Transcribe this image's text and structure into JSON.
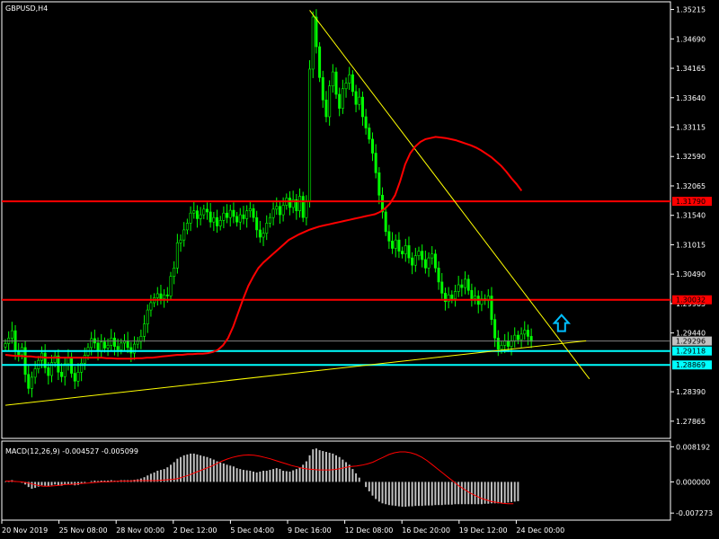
{
  "chart_data": {
    "type": "candlestick",
    "symbol_label": "GBPUSD,H4",
    "colors": {
      "background": "#000000",
      "frame": "#ffffff",
      "bull": "#00ff00",
      "bear": "#00ff00",
      "ma": "#ff0000",
      "resistance": "#ff0000",
      "support": "#00ffff",
      "trendline": "#ffff00",
      "histogram": "#c0c0c0",
      "signal": "#ff0000",
      "arrow": "#00bfff"
    },
    "y_axis": {
      "min": 1.2759,
      "max": 1.3532,
      "ticks": [
        "1.35215",
        "1.34690",
        "1.34165",
        "1.33640",
        "1.33115",
        "1.32590",
        "1.32065",
        "1.31540",
        "1.31015",
        "1.30490",
        "1.29965",
        "1.29440",
        "1.28390",
        "1.27865"
      ]
    },
    "x_axis": {
      "labels": [
        "20 Nov 2019",
        "25 Nov 08:00",
        "28 Nov 00:00",
        "2 Dec 12:00",
        "5 Dec 04:00",
        "9 Dec 16:00",
        "12 Dec 08:00",
        "16 Dec 20:00",
        "19 Dec 12:00",
        "24 Dec 00:00"
      ]
    },
    "closes": [
      1.2925,
      1.2935,
      1.2948,
      1.2912,
      1.2905,
      1.2918,
      1.287,
      1.2845,
      1.2865,
      1.288,
      1.2895,
      1.2908,
      1.2882,
      1.2868,
      1.2891,
      1.2903,
      1.2874,
      1.2866,
      1.2889,
      1.2901,
      1.2872,
      1.2858,
      1.2874,
      1.289,
      1.2904,
      1.2918,
      1.2934,
      1.2926,
      1.2911,
      1.2928,
      1.2917,
      1.2922,
      1.2935,
      1.292,
      1.2914,
      1.2926,
      1.293,
      1.2918,
      1.2908,
      1.2924,
      1.2929,
      1.2938,
      1.296,
      1.2985,
      1.2998,
      1.3007,
      1.3014,
      1.3005,
      1.3012,
      1.301,
      1.3045,
      1.306,
      1.3105,
      1.311,
      1.3128,
      1.314,
      1.3158,
      1.3162,
      1.3148,
      1.3155,
      1.3165,
      1.316,
      1.3142,
      1.315,
      1.3135,
      1.3145,
      1.3158,
      1.315,
      1.3163,
      1.3152,
      1.3142,
      1.3155,
      1.3148,
      1.3162,
      1.3166,
      1.315,
      1.3128,
      1.3115,
      1.3122,
      1.314,
      1.315,
      1.3165,
      1.317,
      1.3155,
      1.3172,
      1.3185,
      1.3168,
      1.3182,
      1.3162,
      1.3188,
      1.315,
      1.3178,
      1.3415,
      1.3508,
      1.3455,
      1.34,
      1.336,
      1.333,
      1.3385,
      1.341,
      1.337,
      1.3345,
      1.338,
      1.339,
      1.3405,
      1.3375,
      1.3352,
      1.3365,
      1.333,
      1.331,
      1.329,
      1.3265,
      1.323,
      1.319,
      1.316,
      1.3125,
      1.3108,
      1.3095,
      1.311,
      1.309,
      1.3085,
      1.31,
      1.3078,
      1.3065,
      1.3082,
      1.309,
      1.3075,
      1.306,
      1.3078,
      1.3085,
      1.306,
      1.3035,
      1.3015,
      1.3,
      1.3012,
      1.3005,
      1.3018,
      1.303,
      1.3025,
      1.304,
      1.302,
      1.3005,
      1.301,
      1.2995,
      1.3005,
      1.3002,
      1.301,
      1.2968,
      1.2935,
      1.2915,
      1.2922,
      1.293,
      1.292,
      1.293,
      1.294,
      1.2932,
      1.2942,
      1.2949,
      1.2938,
      1.2929
    ],
    "ma": [
      1.2905,
      1.2904,
      1.2903,
      1.2903,
      1.2902,
      1.2902,
      1.2901,
      1.2901,
      1.29,
      1.29,
      1.29,
      1.29,
      1.29,
      1.29,
      1.29,
      1.29,
      1.29,
      1.29,
      1.29,
      1.29,
      1.2899,
      1.2899,
      1.2898,
      1.2898,
      1.2898,
      1.2898,
      1.2899,
      1.2899,
      1.29,
      1.29,
      1.2901,
      1.2902,
      1.2903,
      1.2904,
      1.2905,
      1.2905,
      1.2906,
      1.2906,
      1.2907,
      1.2907,
      1.2908,
      1.291,
      1.2914,
      1.2922,
      1.2935,
      1.2955,
      1.298,
      1.3005,
      1.3028,
      1.3045,
      1.306,
      1.307,
      1.3078,
      1.3086,
      1.3094,
      1.3102,
      1.311,
      1.3115,
      1.312,
      1.3124,
      1.3128,
      1.3131,
      1.3134,
      1.3136,
      1.3138,
      1.314,
      1.3142,
      1.3144,
      1.3146,
      1.3148,
      1.315,
      1.3152,
      1.3154,
      1.3156,
      1.316,
      1.3166,
      1.3175,
      1.319,
      1.3215,
      1.3245,
      1.3265,
      1.3277,
      1.3285,
      1.329,
      1.3292,
      1.3294,
      1.3293,
      1.3292,
      1.329,
      1.3288,
      1.3285,
      1.3282,
      1.3279,
      1.3275,
      1.327,
      1.3264,
      1.3258,
      1.325,
      1.3242,
      1.3232,
      1.322,
      1.321,
      1.3198
    ],
    "ma_start_index": 0,
    "levels": {
      "resistance": [
        {
          "value": 1.3179,
          "label": "1.31790"
        },
        {
          "value": 1.30032,
          "label": "1.30032"
        }
      ],
      "support": [
        {
          "value": 1.29118,
          "label": "1.29118"
        },
        {
          "value": 1.28869,
          "label": "1.28869"
        }
      ],
      "current": {
        "value": 1.29296,
        "label": "1.29296"
      }
    },
    "trendlines": [
      {
        "from": {
          "index": 0,
          "price": 1.2815
        },
        "to": {
          "index": 162,
          "price": 1.293
        }
      },
      {
        "from": {
          "index": 92,
          "price": 1.352
        },
        "to": {
          "index": 163,
          "price": 1.291
        }
      }
    ],
    "macd": {
      "label": "MACD(12,26,9) -0.004527 -0.005099",
      "y_min": -0.0085,
      "y_max": 0.0091,
      "ticks": [
        "0.008192",
        "0.000000",
        "-0.007273"
      ],
      "histogram": [
        0.0001,
        0.0003,
        0.0004,
        0.0002,
        0.0,
        -0.0002,
        -0.0006,
        -0.0012,
        -0.0016,
        -0.0014,
        -0.0011,
        -0.0008,
        -0.0009,
        -0.001,
        -0.0008,
        -0.0006,
        -0.0008,
        -0.0009,
        -0.0007,
        -0.0005,
        -0.0006,
        -0.0008,
        -0.0007,
        -0.0004,
        -0.0002,
        0.0,
        0.0002,
        0.0003,
        0.0002,
        0.0003,
        0.0003,
        0.0003,
        0.0004,
        0.0003,
        0.0003,
        0.0004,
        0.0004,
        0.0004,
        0.0004,
        0.0005,
        0.0006,
        0.0008,
        0.0011,
        0.0015,
        0.0019,
        0.0022,
        0.0026,
        0.0028,
        0.003,
        0.0034,
        0.004,
        0.0046,
        0.0054,
        0.0058,
        0.0062,
        0.0064,
        0.0066,
        0.0066,
        0.0064,
        0.0062,
        0.006,
        0.0058,
        0.0055,
        0.0052,
        0.0048,
        0.0045,
        0.0043,
        0.004,
        0.0038,
        0.0036,
        0.0032,
        0.003,
        0.0028,
        0.0027,
        0.0026,
        0.0024,
        0.0022,
        0.0024,
        0.0026,
        0.0026,
        0.0028,
        0.003,
        0.0032,
        0.003,
        0.0026,
        0.0025,
        0.0024,
        0.0027,
        0.003,
        0.0034,
        0.004,
        0.0048,
        0.0062,
        0.0076,
        0.0078,
        0.0074,
        0.0072,
        0.007,
        0.0068,
        0.0066,
        0.0062,
        0.0058,
        0.0052,
        0.0046,
        0.004,
        0.003,
        0.002,
        0.001,
        0.0,
        -0.0012,
        -0.0022,
        -0.0032,
        -0.004,
        -0.0046,
        -0.005,
        -0.0052,
        -0.0054,
        -0.0055,
        -0.0056,
        -0.0057,
        -0.0058,
        -0.0058,
        -0.0057,
        -0.0057,
        -0.0056,
        -0.0056,
        -0.0056,
        -0.0055,
        -0.0055,
        -0.0055,
        -0.0054,
        -0.0054,
        -0.0054,
        -0.0053,
        -0.0053,
        -0.0053,
        -0.0052,
        -0.0052,
        -0.0052,
        -0.0052,
        -0.0052,
        -0.0052,
        -0.0052,
        -0.0052,
        -0.0052,
        -0.0051,
        -0.0051,
        -0.005,
        -0.005,
        -0.005,
        -0.0049,
        -0.0049,
        -0.0048,
        -0.0047,
        -0.0046,
        -0.0045
      ],
      "signal": [
        0.0002,
        0.0002,
        0.0001,
        0.0,
        -0.0002,
        -0.0005,
        -0.0008,
        -0.001,
        -0.001,
        -0.0009,
        -0.0008,
        -0.0006,
        -0.0006,
        -0.0005,
        -0.0004,
        -0.0003,
        -0.0002,
        -0.0001,
        0.0,
        0.0,
        0.0001,
        0.0002,
        0.0002,
        0.0002,
        0.0003,
        0.0003,
        0.0003,
        0.0003,
        0.0003,
        0.0004,
        0.0005,
        0.0006,
        0.0008,
        0.0012,
        0.0016,
        0.0021,
        0.0026,
        0.0031,
        0.0036,
        0.0042,
        0.0048,
        0.0053,
        0.0057,
        0.006,
        0.0062,
        0.0063,
        0.0062,
        0.006,
        0.0057,
        0.0054,
        0.005,
        0.0046,
        0.0042,
        0.0038,
        0.0035,
        0.0032,
        0.003,
        0.0029,
        0.0028,
        0.0028,
        0.0028,
        0.0029,
        0.0031,
        0.0034,
        0.0036,
        0.0037,
        0.0039,
        0.0042,
        0.0046,
        0.0052,
        0.0058,
        0.0064,
        0.0068,
        0.007,
        0.007,
        0.0068,
        0.0064,
        0.0058,
        0.005,
        0.004,
        0.003,
        0.002,
        0.001,
        0.0,
        -0.001,
        -0.0018,
        -0.0026,
        -0.0032,
        -0.0038,
        -0.0042,
        -0.0046,
        -0.0048,
        -0.005,
        -0.0051,
        -0.0051
      ]
    },
    "arrow": {
      "index": 160,
      "price": 1.296
    }
  }
}
